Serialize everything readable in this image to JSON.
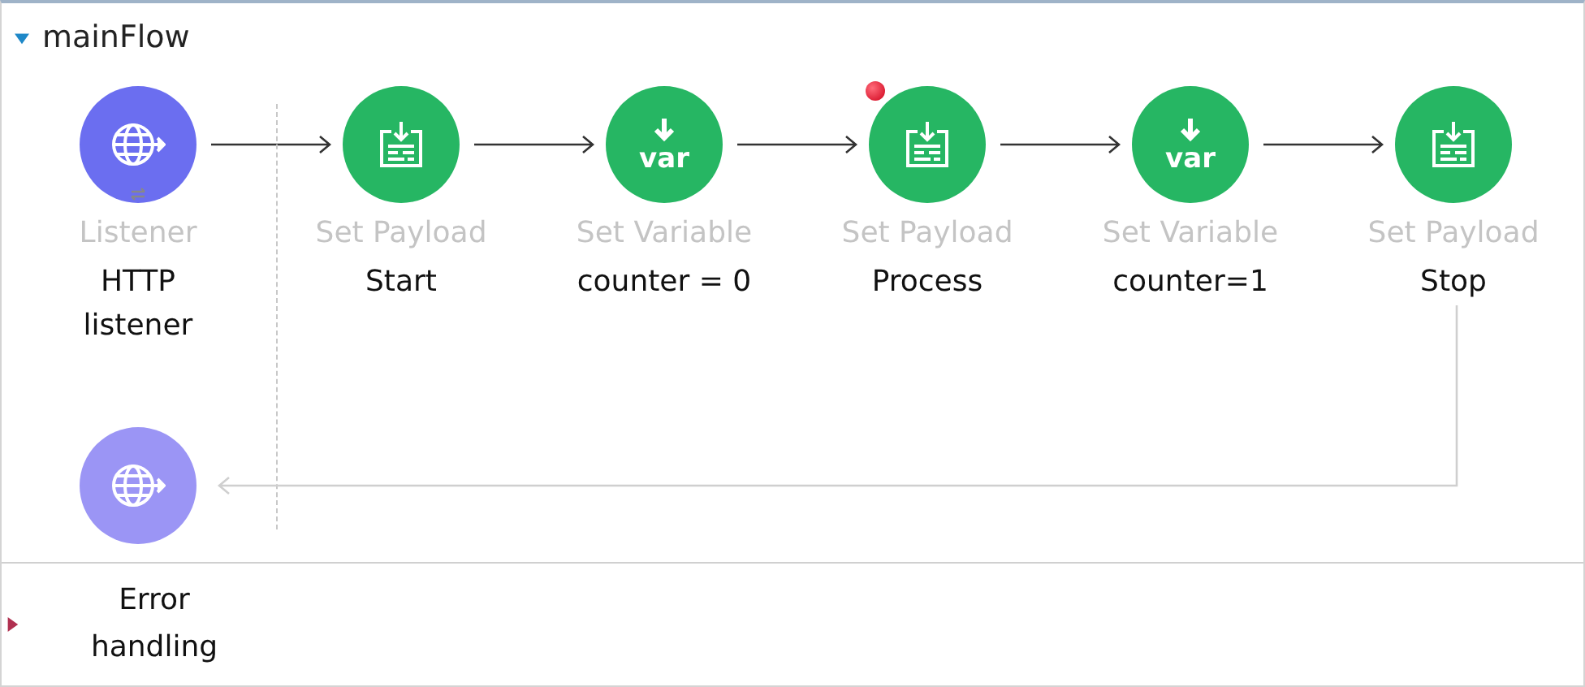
{
  "flow": {
    "name": "mainFlow",
    "expanded": true,
    "nodes": [
      {
        "kind": "listener",
        "type": "Listener",
        "name": "HTTP listener",
        "breakpoint": false
      },
      {
        "kind": "set-payload",
        "type": "Set Payload",
        "name": "Start",
        "breakpoint": false
      },
      {
        "kind": "set-variable",
        "type": "Set Variable",
        "name": "counter = 0",
        "breakpoint": false,
        "icon_text": "var"
      },
      {
        "kind": "set-payload",
        "type": "Set Payload",
        "name": "Process",
        "breakpoint": true
      },
      {
        "kind": "set-variable",
        "type": "Set Variable",
        "name": "counter=1",
        "breakpoint": false,
        "icon_text": "var"
      },
      {
        "kind": "set-payload",
        "type": "Set Payload",
        "name": "Stop",
        "breakpoint": false
      }
    ],
    "response_source": {
      "kind": "listener"
    }
  },
  "error_handling": {
    "label": "Error handling",
    "expanded": false
  }
}
